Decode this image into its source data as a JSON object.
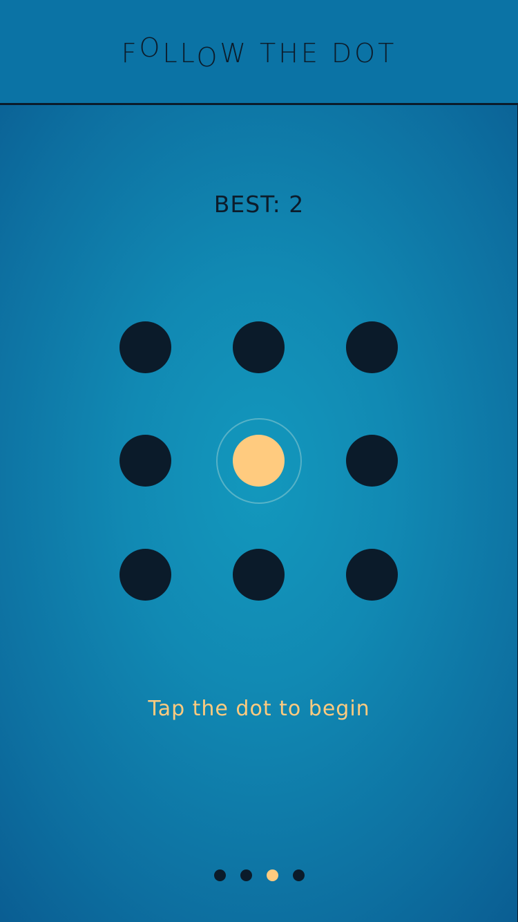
{
  "header": {
    "title_parts": [
      {
        "text": "F",
        "pos": ""
      },
      {
        "text": "O",
        "pos": "hi"
      },
      {
        "text": "LL",
        "pos": ""
      },
      {
        "text": "O",
        "pos": "lo"
      },
      {
        "text": "W THE DOT",
        "pos": ""
      }
    ]
  },
  "score": {
    "best_label": "BEST: 2"
  },
  "grid": {
    "rows": 3,
    "cols": 3,
    "active_index": 4
  },
  "hint": "Tap the dot to begin",
  "pager": {
    "pages": 4,
    "current": 2
  },
  "colors": {
    "dot": "#0b1b2a",
    "active_dot": "#ffcb7f",
    "hint_text": "#ffcb7f",
    "text": "#0c1c2b",
    "header_bg": "#0b73a5"
  }
}
